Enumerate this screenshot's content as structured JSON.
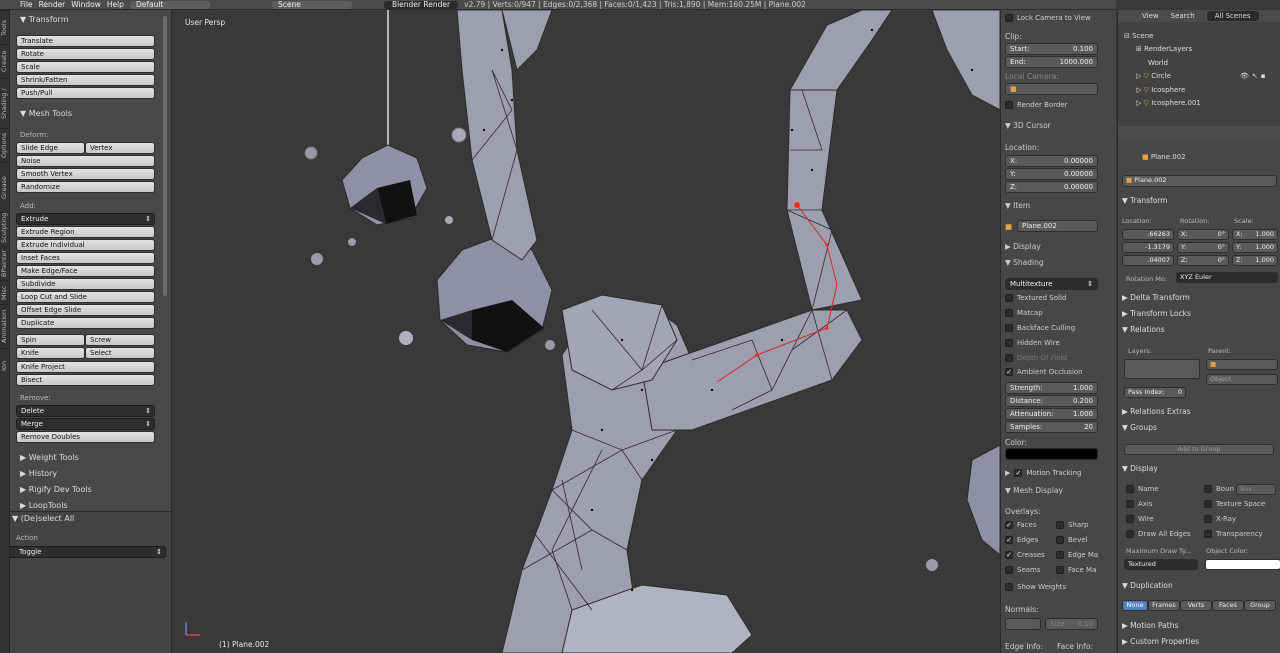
{
  "topbar": {
    "menus": [
      "File",
      "Render",
      "Window",
      "Help"
    ],
    "screen_layout": "Default",
    "scene": "Scene",
    "engine": "Blender Render",
    "stats": "v2.79 | Verts:0/947 | Edges:0/2,368 | Faces:0/1,423 | Tris:1,890 | Mem:160.25M | Plane.002"
  },
  "vtabs": [
    "Tools",
    "Create",
    "Shading / UVs",
    "Options",
    "Grease Pencil",
    "Sculpting",
    "BPainter",
    "Misc",
    "Animation",
    "Ion Tools"
  ],
  "toolshelf": {
    "transform": {
      "title": "Transform",
      "buttons": [
        "Translate",
        "Rotate",
        "Scale",
        "Shrink/Fatten",
        "Push/Pull"
      ]
    },
    "mesh_tools": {
      "title": "Mesh Tools",
      "deform_label": "Deform:",
      "slide_edge": "Slide Edge",
      "vertex": "Vertex",
      "noise": "Noise",
      "smooth_vertex": "Smooth Vertex",
      "randomize": "Randomize",
      "add_label": "Add:",
      "extrude": "Extrude",
      "extrude_region": "Extrude Region",
      "extrude_individual": "Extrude Individual",
      "inset_faces": "Inset Faces",
      "make_edge_face": "Make Edge/Face",
      "subdivide": "Subdivide",
      "loop_cut": "Loop Cut and Slide",
      "offset_edge": "Offset Edge Slide",
      "duplicate": "Duplicate",
      "spin": "Spin",
      "screw": "Screw",
      "knife": "Knife",
      "select": "Select",
      "knife_project": "Knife Project",
      "bisect": "Bisect",
      "remove_label": "Remove:",
      "delete": "Delete",
      "merge": "Merge",
      "remove_doubles": "Remove Doubles"
    },
    "collapsed": [
      "Weight Tools",
      "History",
      "Rigify Dev Tools",
      "LoopTools"
    ],
    "operator": {
      "title": "(De)select All",
      "action_label": "Action",
      "action_value": "Toggle"
    }
  },
  "viewport": {
    "view_label": "User Persp",
    "object_label": "(1) Plane.002"
  },
  "npanel": {
    "lock_camera": "Lock Camera to View",
    "clip_label": "Clip:",
    "clip_start_label": "Start:",
    "clip_start": "0.100",
    "clip_end_label": "End:",
    "clip_end": "1000.000",
    "local_camera": "Local Camera:",
    "render_border": "Render Border",
    "cursor_title": "3D Cursor",
    "location_label": "Location:",
    "cx_label": "X:",
    "cx": "0.00000",
    "cy_label": "Y:",
    "cy": "0.00000",
    "cz_label": "Z:",
    "cz": "0.00000",
    "item_title": "Item",
    "item_name": "Plane.002",
    "display_title": "Display",
    "shading_title": "Shading",
    "shading_mode": "Multitexture",
    "textured_solid": "Textured Solid",
    "matcap": "Matcap",
    "backface_culling": "Backface Culling",
    "hidden_wire": "Hidden Wire",
    "depth_of_field": "Depth Of Field",
    "ambient_occlusion": "Ambient Occlusion",
    "strength_label": "Strength:",
    "strength": "1.000",
    "distance_label": "Distance:",
    "distance": "0.200",
    "attenuation_label": "Attenuation:",
    "attenuation": "1.000",
    "samples_label": "Samples:",
    "samples": "20",
    "color_label": "Color:",
    "motion_tracking": "Motion Tracking",
    "mesh_display": "Mesh Display",
    "overlays_label": "Overlays:",
    "faces": "Faces",
    "sharp": "Sharp",
    "edges": "Edges",
    "bevel": "Bevel",
    "creases": "Creases",
    "edge_ma": "Edge Ma",
    "seams": "Seams",
    "face_ma": "Face Ma",
    "show_weights": "Show Weights",
    "normals_label": "Normals:",
    "size_label": "Size:",
    "size": "0.10",
    "edge_info": "Edge Info:",
    "face_info": "Face Info:"
  },
  "outliner": {
    "view": "View",
    "search": "Search",
    "all_scenes": "All Scenes",
    "items": [
      "Scene",
      "RenderLayers",
      "World",
      "Circle",
      "Icosphere",
      "Icosphere.001"
    ]
  },
  "props": {
    "breadcrumb": "Plane.002",
    "object_name": "Plane.002",
    "transform_title": "Transform",
    "location_label": "Location:",
    "rotation_label": "Rotation:",
    "scale_label": "Scale:",
    "loc": [
      ".66263",
      "-1.3179",
      ".04007"
    ],
    "rot": [
      "X:",
      "0°",
      "Y:",
      "0°",
      "Z:",
      "0°"
    ],
    "rot_x": "0°",
    "rot_y": "0°",
    "rot_z": "0°",
    "scale_x": "1.000",
    "scale_y": "1.000",
    "scale_z": "1.000",
    "sx_label": "X:",
    "sy_label": "Y:",
    "sz_label": "Z:",
    "rotation_mode_label": "Rotation Mo:",
    "rotation_mode": "XYZ Euler",
    "delta_transform": "Delta Transform",
    "transform_locks": "Transform Locks",
    "relations": "Relations",
    "layers_label": "Layers:",
    "parent_label": "Parent:",
    "parent_type": "Object",
    "pass_index_label": "Pass Index:",
    "pass_index": "0",
    "relations_extras": "Relations Extras",
    "groups": "Groups",
    "add_to_group": "Add to Group",
    "display": "Display",
    "name": "Name",
    "bounds": "Boun",
    "box": "Box",
    "axis": "Axis",
    "texture_space": "Texture Space",
    "wire": "Wire",
    "xray": "X-Ray",
    "draw_all_edges": "Draw All Edges",
    "transparency": "Transparency",
    "max_draw_label": "Maximum Draw Ty...",
    "obj_color_label": "Object Color:",
    "max_draw": "Textured",
    "duplication": "Duplication",
    "dup_tabs": [
      "None",
      "Frames",
      "Verts",
      "Faces",
      "Group"
    ],
    "motion_paths": "Motion Paths",
    "custom_props": "Custom Properties"
  },
  "colors": {
    "accent": "#5680c2",
    "panel": "#474747",
    "viewport": "#393939"
  }
}
